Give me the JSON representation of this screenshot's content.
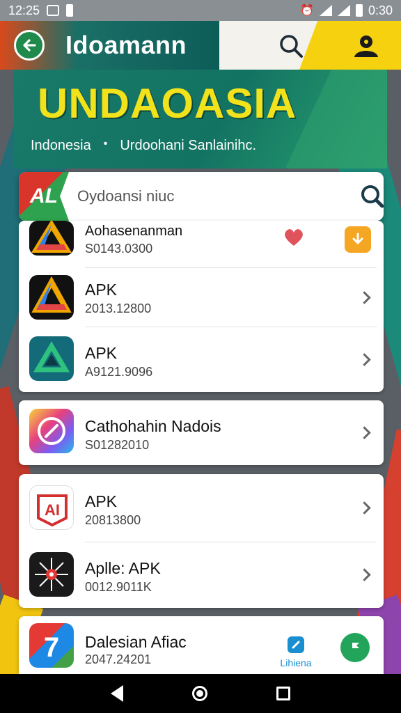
{
  "status_bar": {
    "time_left": "12:25",
    "time_right": "0:30"
  },
  "app_bar": {
    "title": "Idoamann"
  },
  "banner": {
    "title": "UNDAOASIA",
    "subtitle_left": "Indonesia",
    "subtitle_right": "Urdoohani Sanlainihc."
  },
  "search": {
    "logo_text": "AL",
    "placeholder": "Oydoansi niuc"
  },
  "cards": [
    {
      "items": [
        {
          "name": "Aohasenanman",
          "code": "S0143.0300",
          "icon": "drive-triangle-icon"
        },
        {
          "name": "APK",
          "code": "2013.12800",
          "icon": "drive-triangle-icon"
        },
        {
          "name": "APK",
          "code": "A9121.9096",
          "icon": "green-triangle-icon"
        }
      ]
    },
    {
      "items": [
        {
          "name": "Cathohahin Nadois",
          "code": "S01282010",
          "icon": "rainbow-circle-icon"
        }
      ]
    },
    {
      "items": [
        {
          "name": "APK",
          "code": "20813800",
          "icon": "red-emblem-icon"
        },
        {
          "name": "Aplle: APK",
          "code": "0012.9011K",
          "icon": "compass-star-icon"
        }
      ]
    },
    {
      "items": [
        {
          "name": "Dalesian Afiac",
          "code": "2047.24201",
          "icon": "colorful-a-icon",
          "action_label": "Lihiena"
        }
      ]
    }
  ],
  "colors": {
    "accent_green": "#1f8a4c",
    "banner_yellow": "#f2e21b",
    "heart_red": "#e0525c",
    "orange_badge": "#f5a623"
  }
}
